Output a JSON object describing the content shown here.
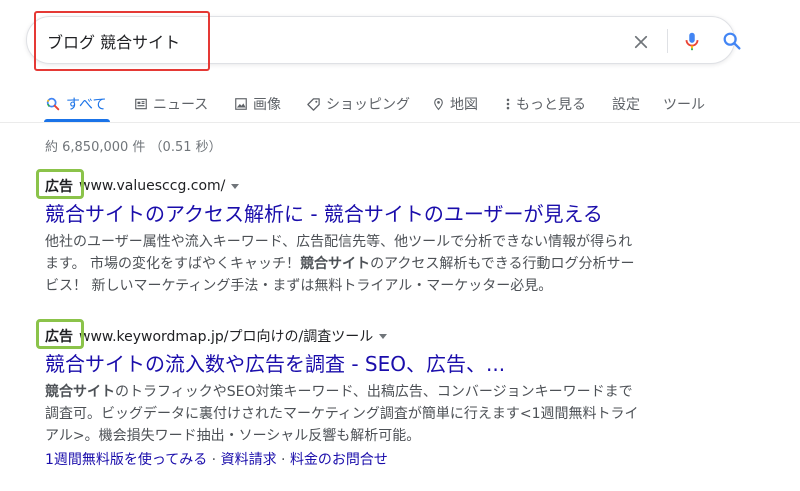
{
  "search": {
    "query": "ブログ 競合サイト"
  },
  "tabs": [
    {
      "label": "すべて",
      "icon": "search-icon"
    },
    {
      "label": "ニュース",
      "icon": "news-icon"
    },
    {
      "label": "画像",
      "icon": "image-icon"
    },
    {
      "label": "ショッピング",
      "icon": "tag-icon"
    },
    {
      "label": "地図",
      "icon": "map-pin-icon"
    },
    {
      "label": "もっと見る",
      "icon": "more-vert-icon"
    },
    {
      "label": "設定"
    },
    {
      "label": "ツール"
    }
  ],
  "result_stats": "約 6,850,000 件 （0.51 秒）",
  "ads": [
    {
      "badge": "広告",
      "url": "www.valuesccg.com/",
      "title": "競合サイトのアクセス解析に - 競合サイトのユーザーが見える",
      "desc_line1": "他社のユーザー属性や流入キーワード、広告配信先等、他ツールで分析できない情報が得られ",
      "desc_line2_pre": "ます。 市場の変化をすばやくキャッチ！",
      "desc_line2_bold": "競合サイト",
      "desc_line2_post": "のアクセス解析もできる行動ログ分析サー",
      "desc_line3": "ビス！ 新しいマーケティング手法・まずは無料トライアル・マーケッター必見。"
    },
    {
      "badge": "広告",
      "url": "www.keywordmap.jp/プロ向けの/調査ツール",
      "title": "競合サイトの流入数や広告を調査 - SEO、広告、...",
      "desc_line1_bold": "競合サイト",
      "desc_line1_post": "のトラフィックやSEO対策キーワード、出稿広告、コンバージョンキーワードまで",
      "desc_line2": "調査可。ビッグデータに裏付けされたマーケティング調査が簡単に行えます<1週間無料トライ",
      "desc_line3": "アル>。機会損失ワード抽出・ソーシャル反響も解析可能。",
      "sitelinks": [
        "1週間無料版を使ってみる",
        "資料請求",
        "料金のお問合せ"
      ],
      "sitelink_sep": " · "
    }
  ],
  "colors": {
    "tab_active": "#1a73e8",
    "ad_title": "#1a0dab",
    "highlight_red": "#e53935",
    "highlight_green": "#8bc34a"
  }
}
